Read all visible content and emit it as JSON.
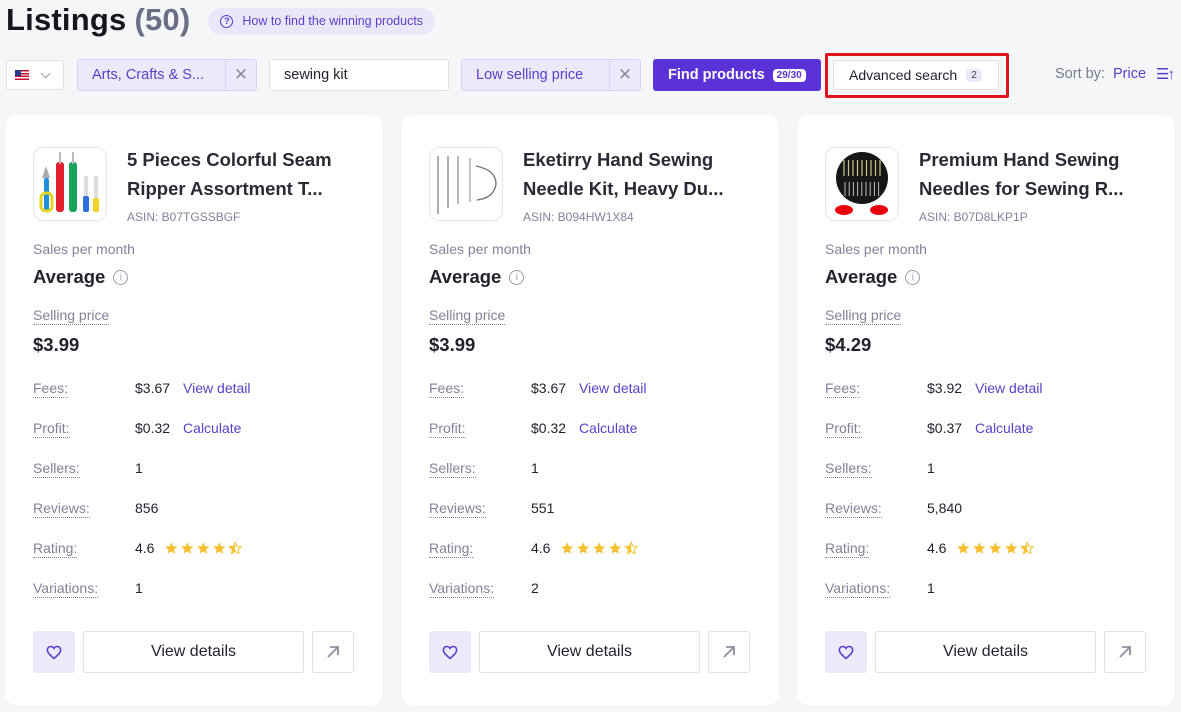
{
  "header": {
    "title": "Listings",
    "count": "(50)",
    "help_label": "How to find the winning products"
  },
  "toolbar": {
    "country": "US",
    "category_filter": "Arts, Crafts & S...",
    "search_value": "sewing kit",
    "search_placeholder": "",
    "price_filter": "Low selling price",
    "find_label": "Find products",
    "find_badge": "29/30",
    "advanced_label": "Advanced search",
    "advanced_badge": "2",
    "sort_label": "Sort by:",
    "sort_value": "Price"
  },
  "colors": {
    "accent": "#5a32d7",
    "highlight_outline": "#e0121b",
    "star": "#f5c232"
  },
  "labels": {
    "sales_per_month": "Sales per month",
    "selling_price": "Selling price",
    "fees": "Fees:",
    "profit": "Profit:",
    "sellers": "Sellers:",
    "reviews": "Reviews:",
    "rating": "Rating:",
    "variations": "Variations:",
    "view_detail": "View detail",
    "calculate": "Calculate",
    "view_details": "View details"
  },
  "products": [
    {
      "name_line1": "5 Pieces Colorful Seam",
      "name_line2": "Ripper Assortment T...",
      "asin": "ASIN: B07TGSSBGF",
      "sales_per_month": "Average",
      "selling_price": "$3.99",
      "fees": "$3.67",
      "profit": "$0.32",
      "sellers": "1",
      "reviews": "856",
      "rating": "4.6",
      "rating_stars": 4.5,
      "variations": "1"
    },
    {
      "name_line1": "Eketirry Hand Sewing",
      "name_line2": "Needle Kit, Heavy Du...",
      "asin": "ASIN: B094HW1X84",
      "sales_per_month": "Average",
      "selling_price": "$3.99",
      "fees": "$3.67",
      "profit": "$0.32",
      "sellers": "1",
      "reviews": "551",
      "rating": "4.6",
      "rating_stars": 4.5,
      "variations": "2"
    },
    {
      "name_line1": "Premium Hand Sewing",
      "name_line2": "Needles for Sewing R...",
      "asin": "ASIN: B07D8LKP1P",
      "sales_per_month": "Average",
      "selling_price": "$4.29",
      "fees": "$3.92",
      "profit": "$0.37",
      "sellers": "1",
      "reviews": "5,840",
      "rating": "4.6",
      "rating_stars": 4.5,
      "variations": "1"
    }
  ]
}
